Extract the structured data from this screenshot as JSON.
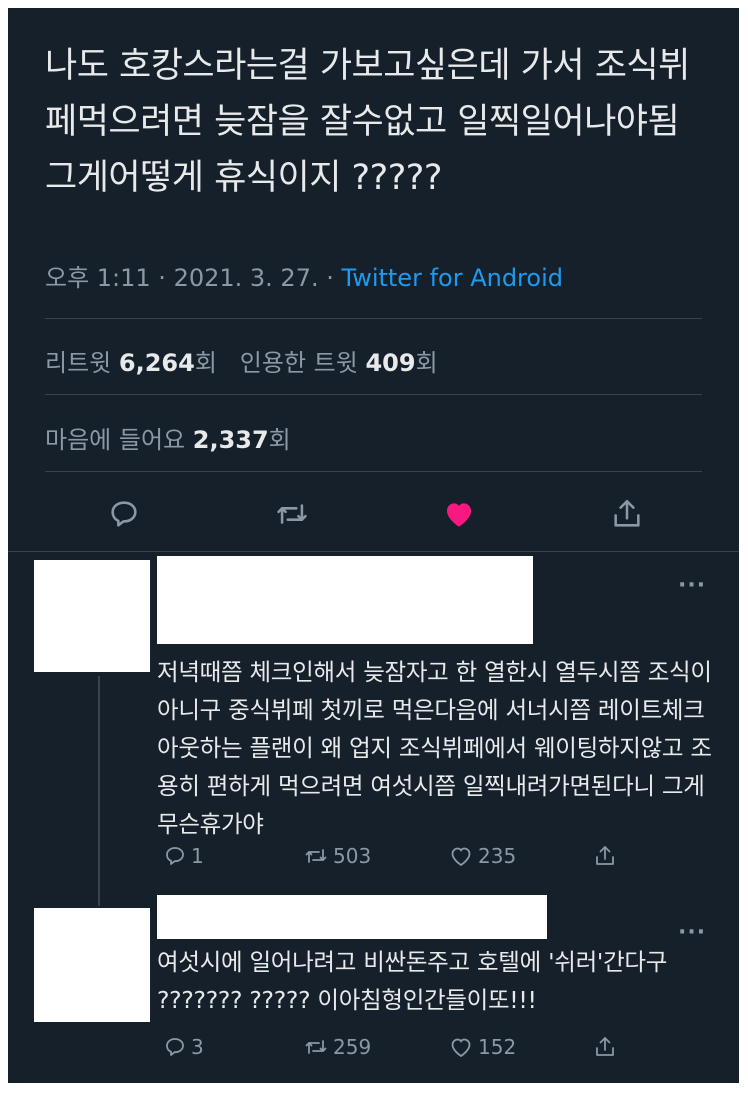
{
  "tweet": {
    "text": "나도 호캉스라는걸 가보고싶은데 가서 조식뷔페먹으려면 늦잠을 잘수없고 일찍일어나야됨 그게어떻게 휴식이지 ?????",
    "time": "오후 1:11 · 2021. 3. 27. · ",
    "source": "Twitter for Android",
    "retweets_label": "리트윗",
    "retweets_count": "6,264",
    "retweets_unit": "회",
    "quotes_label": "인용한 트윗",
    "quotes_count": "409",
    "quotes_unit": "회",
    "likes_label": "마음에 들어요",
    "likes_count": "2,337",
    "likes_unit": "회"
  },
  "actions": [
    {
      "icon": "reply-icon"
    },
    {
      "icon": "retweet-icon"
    },
    {
      "icon": "heart-icon",
      "liked": true,
      "color": "#f91880"
    },
    {
      "icon": "share-icon"
    }
  ],
  "replies": [
    {
      "more": "···",
      "text": "저녁때쯤 체크인해서 늦잠자고 한 열한시 열두시쯤 조식이아니구 중식뷔페 첫끼로 먹은다음에 서너시쯤 레이트체크아웃하는 플랜이 왜 업지 조식뷔페에서 웨이팅하지않고 조용히 편하게 먹으려면 여섯시쯤 일찍내려가면된다니 그게무슨휴가야",
      "replies": "1",
      "retweets": "503",
      "likes": "235"
    },
    {
      "more": "···",
      "text": "여섯시에 일어나려고 비싼돈주고 호텔에 '쉬러'간다구 ??????? ????? 이아침형인간들이또!!!",
      "replies": "3",
      "retweets": "259",
      "likes": "152"
    }
  ]
}
